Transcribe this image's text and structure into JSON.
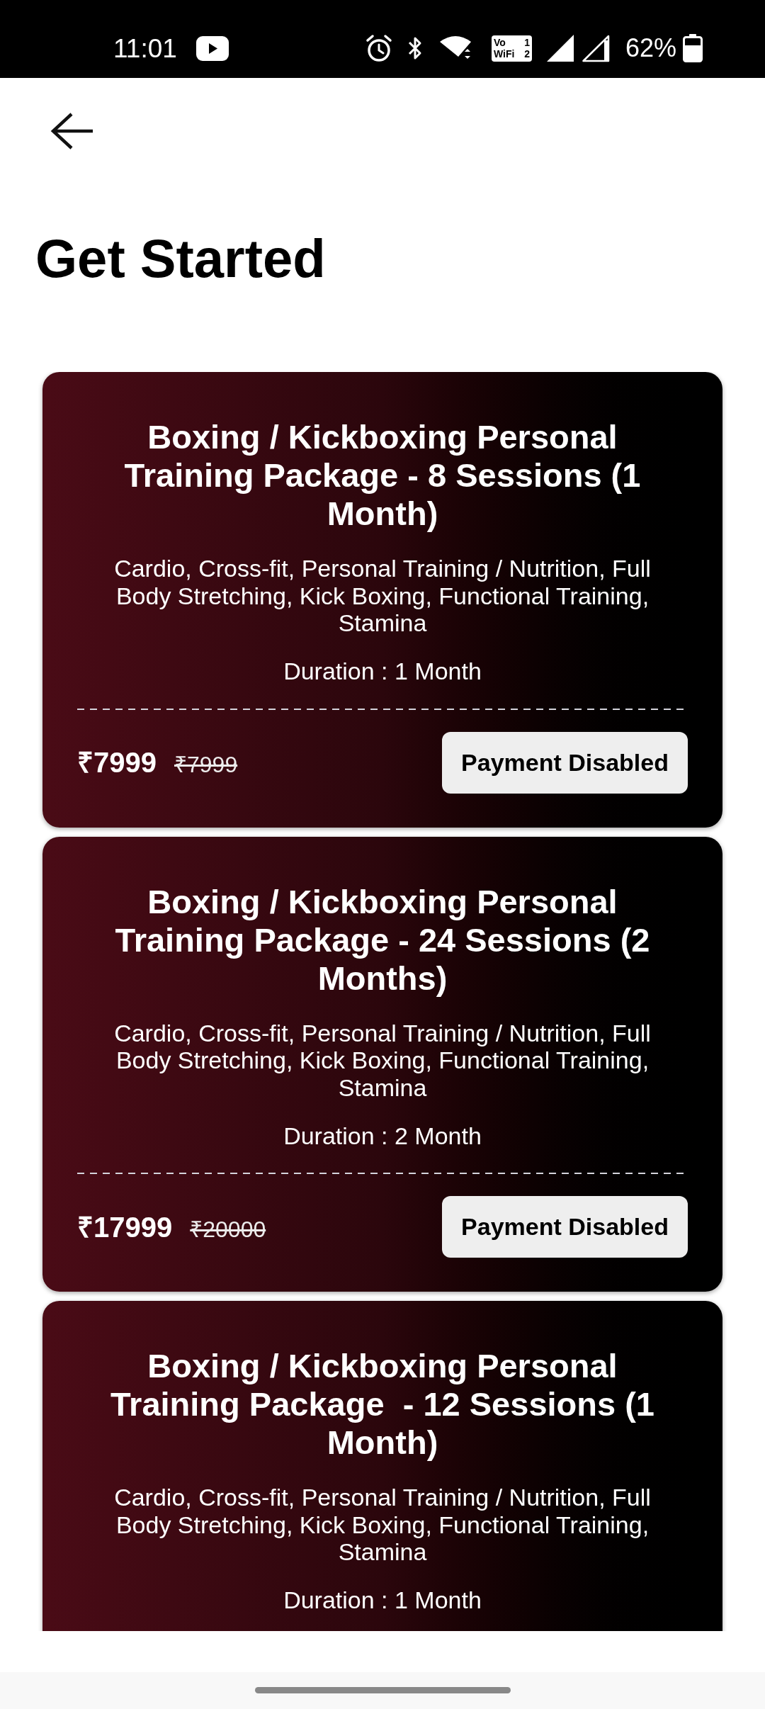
{
  "status_bar": {
    "time": "11:01",
    "wifi_calling_badge": [
      {
        "text": "Vo",
        "sim": "1"
      },
      {
        "text": "WiFi",
        "sim": "2"
      }
    ],
    "battery": "62%"
  },
  "header": {
    "title": "Get Started"
  },
  "packages": [
    {
      "title": "Boxing / Kickboxing Personal Training Package - 8 Sessions (1 Month)",
      "description": "Cardio, Cross-fit, Personal Training / Nutrition, Full Body Stretching, Kick Boxing, Functional Training, Stamina",
      "duration": "Duration : 1 Month",
      "price": "₹7999",
      "original_price": "₹7999",
      "button": "Payment Disabled"
    },
    {
      "title": "Boxing / Kickboxing Personal Training Package - 24 Sessions (2 Months)",
      "description": "Cardio, Cross-fit, Personal Training / Nutrition, Full Body Stretching, Kick Boxing, Functional Training, Stamina",
      "duration": "Duration : 2 Month",
      "price": "₹17999",
      "original_price": "₹20000",
      "button": "Payment Disabled"
    },
    {
      "title": "Boxing / Kickboxing Personal Training Package  - 12 Sessions (1 Month)",
      "description": "Cardio, Cross-fit, Personal Training / Nutrition, Full Body Stretching, Kick Boxing, Functional Training, Stamina",
      "duration": "Duration : 1 Month"
    }
  ]
}
